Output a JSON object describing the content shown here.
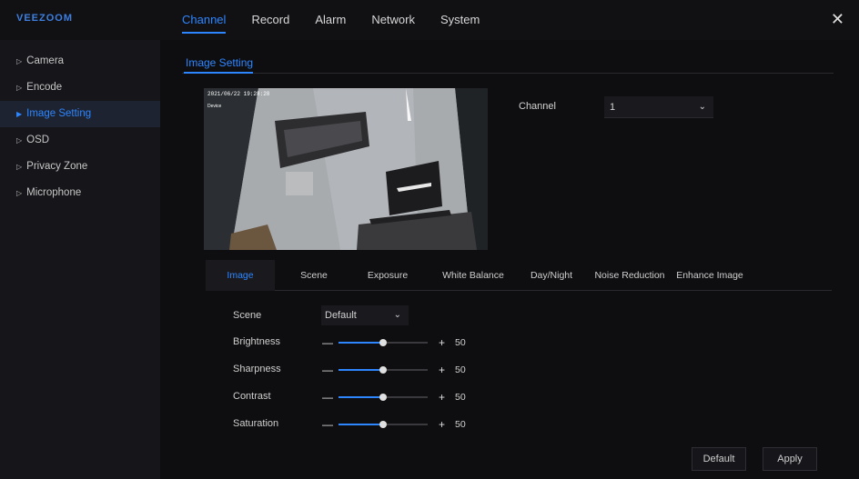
{
  "brand": {
    "logo": "VEEZOOM",
    "accent": "#2e86ff"
  },
  "topnav": {
    "tabs": [
      {
        "label": "Channel",
        "active": true
      },
      {
        "label": "Record"
      },
      {
        "label": "Alarm"
      },
      {
        "label": "Network"
      },
      {
        "label": "System"
      }
    ],
    "close_icon": "close-icon"
  },
  "sidebar": {
    "items": [
      {
        "label": "Camera"
      },
      {
        "label": "Encode"
      },
      {
        "label": "Image Setting",
        "active": true
      },
      {
        "label": "OSD"
      },
      {
        "label": "Privacy Zone"
      },
      {
        "label": "Microphone"
      }
    ]
  },
  "main": {
    "section_title": "Image Setting",
    "preview": {
      "timestamp": "2021/06/22 19:28:28",
      "camera_name": "Device"
    },
    "channel": {
      "label": "Channel",
      "value": "1"
    },
    "subtabs": [
      {
        "label": "Image",
        "active": true
      },
      {
        "label": "Scene"
      },
      {
        "label": "Exposure"
      },
      {
        "label": "White Balance"
      },
      {
        "label": "Day/Night"
      },
      {
        "label": "Noise Reduction"
      },
      {
        "label": "Enhance Image"
      }
    ],
    "scene": {
      "label": "Scene",
      "value": "Default"
    },
    "sliders": [
      {
        "label": "Brightness",
        "value": "50",
        "level": 0.5
      },
      {
        "label": "Sharpness",
        "value": "50",
        "level": 0.5
      },
      {
        "label": "Contrast",
        "value": "50",
        "level": 0.5
      },
      {
        "label": "Saturation",
        "value": "50",
        "level": 0.5
      }
    ],
    "buttons": {
      "default": "Default",
      "apply": "Apply"
    }
  }
}
